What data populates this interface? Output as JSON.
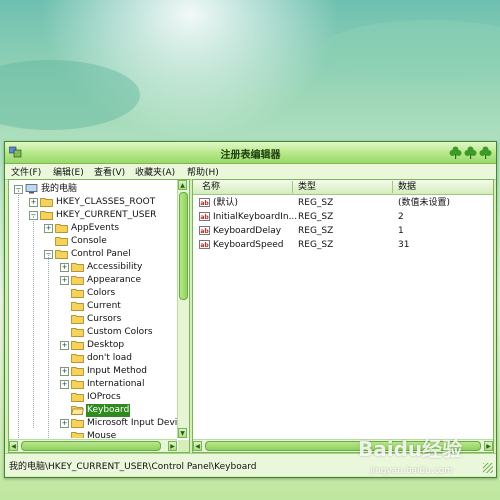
{
  "window": {
    "title": "注册表编辑器"
  },
  "menubar": {
    "items": [
      "文件(F)",
      "编辑(E)",
      "查看(V)",
      "收藏夹(A)",
      "帮助(H)"
    ]
  },
  "tree": {
    "items": [
      {
        "label": "我的电脑",
        "depth": 0,
        "expander": "minus",
        "icon": "computer-icon",
        "selected": false
      },
      {
        "label": "HKEY_CLASSES_ROOT",
        "depth": 1,
        "expander": "plus",
        "icon": "folder-icon",
        "selected": false
      },
      {
        "label": "HKEY_CURRENT_USER",
        "depth": 1,
        "expander": "minus",
        "icon": "folder-icon",
        "selected": false
      },
      {
        "label": "AppEvents",
        "depth": 2,
        "expander": "plus",
        "icon": "folder-icon",
        "selected": false
      },
      {
        "label": "Console",
        "depth": 2,
        "expander": "none",
        "icon": "folder-icon",
        "selected": false
      },
      {
        "label": "Control Panel",
        "depth": 2,
        "expander": "minus",
        "icon": "folder-icon",
        "selected": false
      },
      {
        "label": "Accessibility",
        "depth": 3,
        "expander": "plus",
        "icon": "folder-icon",
        "selected": false
      },
      {
        "label": "Appearance",
        "depth": 3,
        "expander": "plus",
        "icon": "folder-icon",
        "selected": false
      },
      {
        "label": "Colors",
        "depth": 3,
        "expander": "none",
        "icon": "folder-icon",
        "selected": false
      },
      {
        "label": "Current",
        "depth": 3,
        "expander": "none",
        "icon": "folder-icon",
        "selected": false
      },
      {
        "label": "Cursors",
        "depth": 3,
        "expander": "none",
        "icon": "folder-icon",
        "selected": false
      },
      {
        "label": "Custom Colors",
        "depth": 3,
        "expander": "none",
        "icon": "folder-icon",
        "selected": false
      },
      {
        "label": "Desktop",
        "depth": 3,
        "expander": "plus",
        "icon": "folder-icon",
        "selected": false
      },
      {
        "label": "don't load",
        "depth": 3,
        "expander": "none",
        "icon": "folder-icon",
        "selected": false
      },
      {
        "label": "Input Method",
        "depth": 3,
        "expander": "plus",
        "icon": "folder-icon",
        "selected": false
      },
      {
        "label": "International",
        "depth": 3,
        "expander": "plus",
        "icon": "folder-icon",
        "selected": false
      },
      {
        "label": "IOProcs",
        "depth": 3,
        "expander": "none",
        "icon": "folder-icon",
        "selected": false
      },
      {
        "label": "Keyboard",
        "depth": 3,
        "expander": "none",
        "icon": "folder-open-icon",
        "selected": true
      },
      {
        "label": "Microsoft Input Devi",
        "depth": 3,
        "expander": "plus",
        "icon": "folder-icon",
        "selected": false
      },
      {
        "label": "Mouse",
        "depth": 3,
        "expander": "none",
        "icon": "folder-icon",
        "selected": false
      }
    ]
  },
  "list": {
    "headers": {
      "name": "名称",
      "type": "类型",
      "data": "数据"
    },
    "rows": [
      {
        "name": "(默认)",
        "type": "REG_SZ",
        "data": "(数值未设置)"
      },
      {
        "name": "InitialKeyboardIn...",
        "type": "REG_SZ",
        "data": "2"
      },
      {
        "name": "KeyboardDelay",
        "type": "REG_SZ",
        "data": "1"
      },
      {
        "name": "KeyboardSpeed",
        "type": "REG_SZ",
        "data": "31"
      }
    ]
  },
  "status": {
    "path": "我的电脑\\HKEY_CURRENT_USER\\Control Panel\\Keyboard"
  },
  "watermark": {
    "logo": "Baidu经验",
    "url": "jingyan.baidu.com"
  },
  "colors": {
    "accent": "#2f8a1f",
    "window_frame": "#3f8a2c",
    "titlebar": "#b9e98d"
  }
}
